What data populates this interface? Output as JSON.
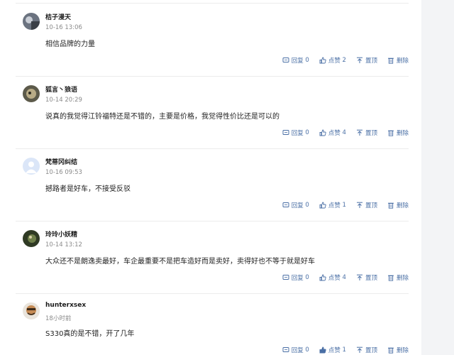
{
  "comments": [
    {
      "username": "桔子漫天",
      "time": "10-16 13:06",
      "content": "相信品牌的力量",
      "reply_label": "回复",
      "reply_count": "0",
      "like_label": "点赞",
      "like_count": "2",
      "top_label": "置顶",
      "delete_label": "删除"
    },
    {
      "username": "狐言丶狼语",
      "time": "10-14 20:29",
      "content": "说真的我觉得江铃福特还是不错的，主要是价格，我觉得性价比还是可以的",
      "reply_label": "回复",
      "reply_count": "0",
      "like_label": "点赞",
      "like_count": "4",
      "top_label": "置顶",
      "delete_label": "删除"
    },
    {
      "username": "梵蒂冈纠结",
      "time": "10-16 09:53",
      "content": "撼路者是好车，不接受反驳",
      "reply_label": "回复",
      "reply_count": "0",
      "like_label": "点赞",
      "like_count": "1",
      "top_label": "置顶",
      "delete_label": "删除"
    },
    {
      "username": "玲玲小妖精",
      "time": "10-14 13:12",
      "content": "大众还不是朗逸卖最好，车企最重要不是把车造好而是卖好，卖得好也不等于就是好车",
      "reply_label": "回复",
      "reply_count": "0",
      "like_label": "点赞",
      "like_count": "4",
      "top_label": "置顶",
      "delete_label": "删除"
    },
    {
      "username": "hunterxsex",
      "time": "18小时前",
      "content": "S330真的是不错，开了几年",
      "reply_label": "回复",
      "reply_count": "0",
      "like_label": "点赞",
      "like_count": "1",
      "top_label": "置顶",
      "delete_label": "删除"
    }
  ],
  "icons": {
    "reply": "comment-icon",
    "like": "thumbs-up-icon",
    "top": "pin-to-top-icon",
    "delete": "trash-icon"
  },
  "colors": {
    "action": "#4a6fa5",
    "divider": "#ececec",
    "background": "#f3f4f6"
  }
}
